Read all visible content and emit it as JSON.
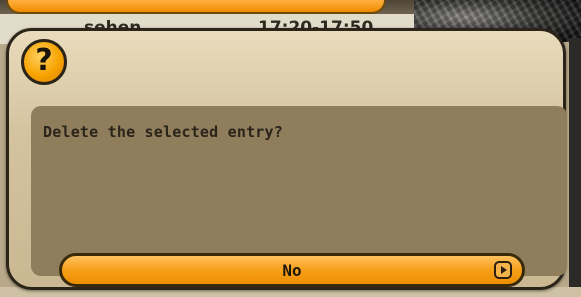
{
  "background": {
    "list_row_title": "sehen",
    "list_row_time": "17:20-17:50"
  },
  "dialog": {
    "icon": "question-mark-icon",
    "icon_glyph": "?",
    "message": "Delete the selected entry?",
    "button_label": "No",
    "button_icon": "play-icon"
  },
  "colors": {
    "accent_orange": "#f8a21e",
    "dialog_bg": "#d4c39f",
    "message_panel_bg": "#8f7d5c",
    "border": "#2b2418"
  }
}
